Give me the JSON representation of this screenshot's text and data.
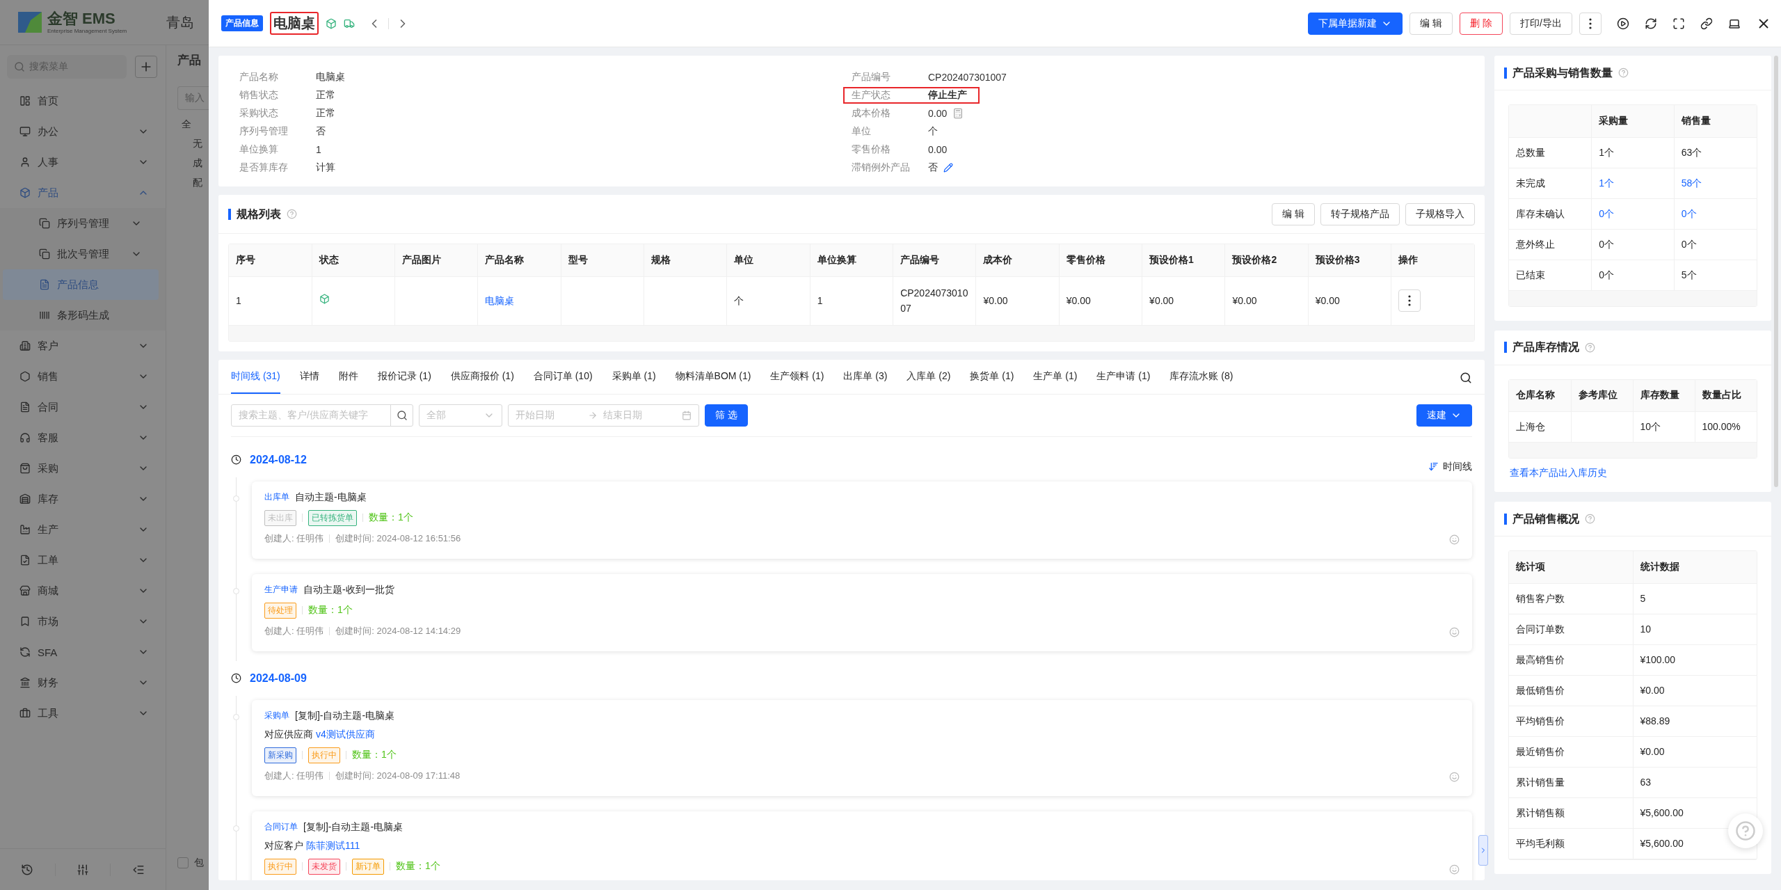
{
  "backdrop": {
    "logo_name": "金智 EMS",
    "logo_tagline": "Enterprise Management System",
    "header_text": "青岛",
    "search_placeholder": "搜索菜单",
    "page_title": "产品",
    "filter_placeholder": "输入",
    "tree": [
      "全",
      "无",
      "成",
      "配"
    ],
    "footer_checkbox": {
      "label": "包",
      "checked": false
    },
    "menu": [
      {
        "label": "首页",
        "expandable": false,
        "expanded": false,
        "selected": false
      },
      {
        "label": "办公",
        "expandable": true,
        "expanded": false,
        "selected": false
      },
      {
        "label": "人事",
        "expandable": true,
        "expanded": false,
        "selected": false
      },
      {
        "label": "产品",
        "expandable": true,
        "expanded": true,
        "selected": false,
        "children": [
          {
            "label": "序列号管理",
            "expandable": true,
            "selected": false
          },
          {
            "label": "批次号管理",
            "expandable": true,
            "selected": false
          },
          {
            "label": "产品信息",
            "expandable": false,
            "selected": true
          },
          {
            "label": "条形码生成",
            "expandable": false,
            "selected": false
          }
        ]
      },
      {
        "label": "客户",
        "expandable": true,
        "expanded": false,
        "selected": false
      },
      {
        "label": "销售",
        "expandable": true,
        "expanded": false,
        "selected": false
      },
      {
        "label": "合同",
        "expandable": true,
        "expanded": false,
        "selected": false
      },
      {
        "label": "客服",
        "expandable": true,
        "expanded": false,
        "selected": false
      },
      {
        "label": "采购",
        "expandable": true,
        "expanded": false,
        "selected": false
      },
      {
        "label": "库存",
        "expandable": true,
        "expanded": false,
        "selected": false
      },
      {
        "label": "生产",
        "expandable": true,
        "expanded": false,
        "selected": false
      },
      {
        "label": "工单",
        "expandable": true,
        "expanded": false,
        "selected": false
      },
      {
        "label": "商城",
        "expandable": true,
        "expanded": false,
        "selected": false
      },
      {
        "label": "市场",
        "expandable": true,
        "expanded": false,
        "selected": false
      },
      {
        "label": "SFA",
        "expandable": true,
        "expanded": false,
        "selected": false
      },
      {
        "label": "财务",
        "expandable": true,
        "expanded": false,
        "selected": false
      },
      {
        "label": "工具",
        "expandable": true,
        "expanded": false,
        "selected": false
      }
    ]
  },
  "drawer": {
    "tag": "产品信息",
    "title": "电脑桌",
    "title_highlighted": true,
    "primary_button": "下属单据新建",
    "buttons": [
      {
        "label": "编 辑",
        "kind": "default"
      },
      {
        "label": "删 除",
        "kind": "danger"
      },
      {
        "label": "打印/导出",
        "kind": "default"
      }
    ]
  },
  "info": {
    "left": [
      {
        "label": "产品名称",
        "value": "电脑桌",
        "kind": "plain",
        "highlighted": false
      },
      {
        "label": "销售状态",
        "value": "正常",
        "kind": "plain",
        "highlighted": false
      },
      {
        "label": "采购状态",
        "value": "正常",
        "kind": "plain",
        "highlighted": false
      },
      {
        "label": "序列号管理",
        "value": "否",
        "kind": "plain",
        "highlighted": false
      },
      {
        "label": "单位换算",
        "value": "1",
        "kind": "plain",
        "highlighted": false
      },
      {
        "label": "是否算库存",
        "value": "计算",
        "kind": "plain",
        "highlighted": false
      }
    ],
    "right": [
      {
        "label": "产品编号",
        "value": "CP202407301007",
        "kind": "plain",
        "highlighted": false
      },
      {
        "label": "生产状态",
        "value": "停止生产",
        "kind": "plain",
        "highlighted": true
      },
      {
        "label": "成本价格",
        "value": "0.00",
        "kind": "calculator",
        "highlighted": false
      },
      {
        "label": "单位",
        "value": "个",
        "kind": "plain",
        "highlighted": false
      },
      {
        "label": "零售价格",
        "value": "0.00",
        "kind": "plain",
        "highlighted": false
      },
      {
        "label": "滞销例外产品",
        "value": "否",
        "kind": "editable",
        "highlighted": false
      }
    ]
  },
  "spec_list": {
    "title": "规格列表",
    "buttons": [
      "编 辑",
      "转子规格产品",
      "子规格导入"
    ],
    "columns": [
      "序号",
      "状态",
      "产品图片",
      "产品名称",
      "型号",
      "规格",
      "单位",
      "单位换算",
      "产品编号",
      "成本价",
      "零售价格",
      "预设价格1",
      "预设价格2",
      "预设价格3",
      "操作"
    ],
    "rows": [
      {
        "cells": [
          {
            "kind": "text",
            "text": "1"
          },
          {
            "kind": "status"
          },
          {
            "kind": "empty"
          },
          {
            "kind": "link",
            "text": "电脑桌"
          },
          {
            "kind": "empty"
          },
          {
            "kind": "empty"
          },
          {
            "kind": "text",
            "text": "个"
          },
          {
            "kind": "text",
            "text": "1"
          },
          {
            "kind": "text",
            "text": "CP202407301007"
          },
          {
            "kind": "text",
            "text": "¥0.00"
          },
          {
            "kind": "text",
            "text": "¥0.00"
          },
          {
            "kind": "text",
            "text": "¥0.00"
          },
          {
            "kind": "text",
            "text": "¥0.00"
          },
          {
            "kind": "text",
            "text": "¥0.00"
          },
          {
            "kind": "action"
          }
        ]
      }
    ]
  },
  "tabs": [
    {
      "label": "时间线 (31)",
      "selected": true
    },
    {
      "label": "详情",
      "selected": false
    },
    {
      "label": "附件",
      "selected": false
    },
    {
      "label": "报价记录 (1)",
      "selected": false
    },
    {
      "label": "供应商报价 (1)",
      "selected": false
    },
    {
      "label": "合同订单 (10)",
      "selected": false
    },
    {
      "label": "采购单 (1)",
      "selected": false
    },
    {
      "label": "物料清单BOM (1)",
      "selected": false
    },
    {
      "label": "生产领料 (1)",
      "selected": false
    },
    {
      "label": "出库单 (3)",
      "selected": false
    },
    {
      "label": "入库单 (2)",
      "selected": false
    },
    {
      "label": "换货单 (1)",
      "selected": false
    },
    {
      "label": "生产单 (1)",
      "selected": false
    },
    {
      "label": "生产申请 (1)",
      "selected": false
    },
    {
      "label": "库存流水账 (8)",
      "selected": false
    }
  ],
  "filters": {
    "search_placeholder": "搜索主题、客户/供应商关键字",
    "select_value": "全部",
    "start_placeholder": "开始日期",
    "end_placeholder": "结束日期",
    "filter_button": "筛 选",
    "quick_button": "速建",
    "sort_label": "时间线"
  },
  "timeline": [
    {
      "date": "2024-08-12",
      "entries": [
        {
          "type": "出库单",
          "title": "自动主题-电脑桌",
          "tags": [
            {
              "text": "未出库",
              "color": "#bfbfbf"
            },
            {
              "text": "已转拣货单",
              "color": "#36b37e"
            }
          ],
          "quantity": "数量：1个",
          "creator": "创建人: 任明伟",
          "created": "创建时间: 2024-08-12 16:51:56"
        },
        {
          "type": "生产申请",
          "title": "自动主题-收到一批货",
          "tags": [
            {
              "text": "待处理",
              "color": "#fa9c1b"
            }
          ],
          "quantity": "数量：1个",
          "creator": "创建人: 任明伟",
          "created": "创建时间: 2024-08-12 14:14:29"
        }
      ]
    },
    {
      "date": "2024-08-09",
      "entries": [
        {
          "type": "采购单",
          "title": "[复制]-自动主题-电脑桌",
          "relation_label": "对应供应商",
          "relation_link": "v4测试供应商",
          "tags": [
            {
              "text": "新采购",
              "color": "#2f6bdc"
            },
            {
              "text": "执行中",
              "color": "#fa9c1b"
            }
          ],
          "quantity": "数量：1个",
          "creator": "创建人: 任明伟",
          "created": "创建时间: 2024-08-09 17:11:48"
        },
        {
          "type": "合同订单",
          "title": "[复制]-自动主题-电脑桌",
          "relation_label": "对应客户",
          "relation_link": "陈菲测试111",
          "tags": [
            {
              "text": "执行中",
              "color": "#fa9c1b"
            },
            {
              "text": "未发货",
              "color": "#f5475b"
            },
            {
              "text": "新订单",
              "color": "#f59a00"
            }
          ],
          "quantity": "数量：1个"
        }
      ]
    }
  ],
  "purchase_sales": {
    "title": "产品采购与销售数量",
    "columns": [
      "采购量",
      "销售量"
    ],
    "rows": [
      {
        "label": "总数量",
        "values": [
          {
            "text": "1个",
            "link": false
          },
          {
            "text": "63个",
            "link": false
          }
        ]
      },
      {
        "label": "未完成",
        "values": [
          {
            "text": "1个",
            "link": true
          },
          {
            "text": "58个",
            "link": true
          }
        ]
      },
      {
        "label": "库存未确认",
        "values": [
          {
            "text": "0个",
            "link": true
          },
          {
            "text": "0个",
            "link": true
          }
        ]
      },
      {
        "label": "意外终止",
        "values": [
          {
            "text": "0个",
            "link": false
          },
          {
            "text": "0个",
            "link": false
          }
        ]
      },
      {
        "label": "已结束",
        "values": [
          {
            "text": "0个",
            "link": false
          },
          {
            "text": "5个",
            "link": false
          }
        ]
      }
    ]
  },
  "inventory": {
    "title": "产品库存情况",
    "columns": [
      "仓库名称",
      "参考库位",
      "库存数量",
      "数量占比"
    ],
    "rows": [
      {
        "cells": [
          "上海仓",
          null,
          "10个",
          "100.00%"
        ]
      }
    ],
    "history_link": "查看本产品出入库历史"
  },
  "sales_overview": {
    "title": "产品销售概况",
    "columns": [
      "统计项",
      "统计数据"
    ],
    "rows": [
      {
        "label": "销售客户数",
        "value": "5"
      },
      {
        "label": "合同订单数",
        "value": "10"
      },
      {
        "label": "最高销售价",
        "value": "¥100.00"
      },
      {
        "label": "最低销售价",
        "value": "¥0.00"
      },
      {
        "label": "平均销售价",
        "value": "¥88.89"
      },
      {
        "label": "最近销售价",
        "value": "¥0.00"
      },
      {
        "label": "累计销售量",
        "value": "63"
      },
      {
        "label": "累计销售额",
        "value": "¥5,600.00"
      },
      {
        "label": "平均毛利额",
        "value": "¥5,600.00"
      }
    ]
  }
}
